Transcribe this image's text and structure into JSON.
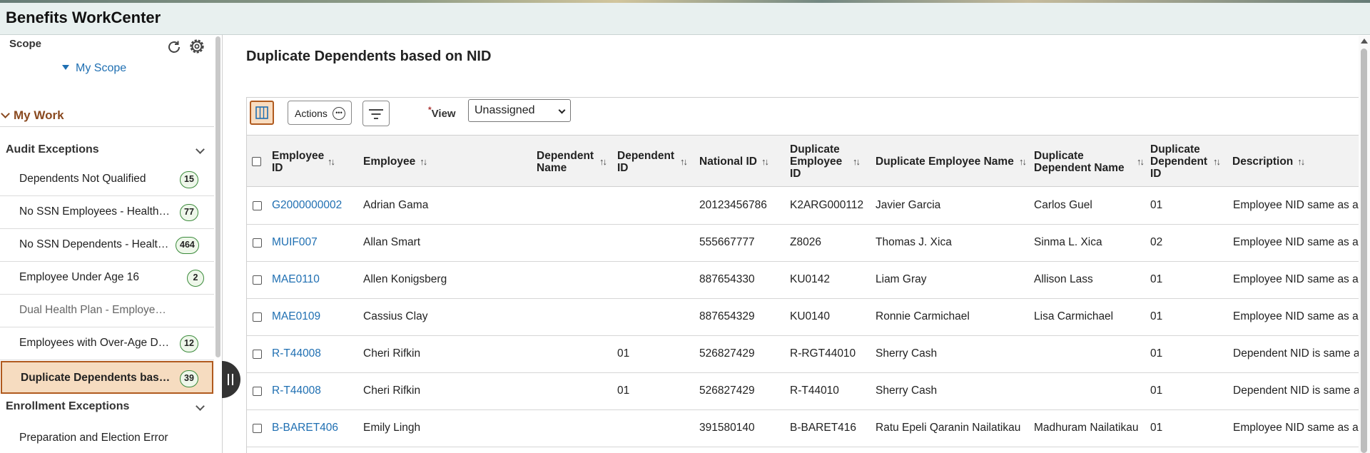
{
  "app": {
    "title": "Benefits WorkCenter"
  },
  "sidebar": {
    "scope_title": "Scope",
    "scope_link": "My Scope",
    "my_work": "My Work",
    "groups": [
      {
        "label": "Audit Exceptions"
      },
      {
        "label": "Enrollment Exceptions"
      }
    ],
    "items": [
      {
        "label": "Dependents Not Qualified",
        "count": "15"
      },
      {
        "label": "No SSN Employees - Health…",
        "count": "77"
      },
      {
        "label": "No SSN Dependents - Healt…",
        "count": "464"
      },
      {
        "label": "Employee Under Age 16",
        "count": "2"
      },
      {
        "label": "Dual Health Plan - Employe…",
        "count": ""
      },
      {
        "label": "Employees with Over-Age D…",
        "count": "12"
      },
      {
        "label": "Duplicate Dependents bas…",
        "count": "39"
      },
      {
        "label": "Preparation and Election Error",
        "count": ""
      }
    ]
  },
  "main": {
    "title": "Duplicate Dependents based on NID",
    "toolbar": {
      "actions_label": "Actions",
      "view_required": "*",
      "view_label": "View",
      "view_value": "Unassigned"
    },
    "columns": [
      "Employee ID",
      "Employee",
      "Dependent Name",
      "Dependent ID",
      "National ID",
      "Duplicate Employee ID",
      "Duplicate Employee Name",
      "Duplicate Dependent Name",
      "Duplicate Dependent ID",
      "Description"
    ],
    "rows": [
      [
        "G2000000002",
        "Adrian Gama",
        "",
        "",
        "20123456786",
        "K2ARG000112",
        "Javier Garcia",
        "Carlos Guel",
        "01",
        "Employee NID same as a"
      ],
      [
        "MUIF007",
        "Allan Smart",
        "",
        "",
        "555667777",
        "Z8026",
        "Thomas J. Xica",
        "Sinma L. Xica",
        "02",
        "Employee NID same as a"
      ],
      [
        "MAE0110",
        "Allen Konigsberg",
        "",
        "",
        "887654330",
        "KU0142",
        "Liam Gray",
        "Allison Lass",
        "01",
        "Employee NID same as a"
      ],
      [
        "MAE0109",
        "Cassius Clay",
        "",
        "",
        "887654329",
        "KU0140",
        "Ronnie Carmichael",
        "Lisa Carmichael",
        "01",
        "Employee NID same as a"
      ],
      [
        "R-T44008",
        "Cheri Rifkin",
        "",
        "01",
        "526827429",
        "R-RGT44010",
        "Sherry Cash",
        "",
        "01",
        "Dependent NID is same a"
      ],
      [
        "R-T44008",
        "Cheri Rifkin",
        "",
        "01",
        "526827429",
        "R-T44010",
        "Sherry Cash",
        "",
        "01",
        "Dependent NID is same a"
      ],
      [
        "B-BARET406",
        "Emily Lingh",
        "",
        "",
        "391580140",
        "B-BARET416",
        "Ratu Epeli Qaranin Nailatikau",
        "Madhuram Nailatikau",
        "01",
        "Employee NID same as a"
      ]
    ]
  },
  "colors": {
    "accent": "#b05a1e",
    "link": "#1f6fb2",
    "badge_border": "#3a8a3a",
    "selected_bg": "#f6dcc0"
  }
}
